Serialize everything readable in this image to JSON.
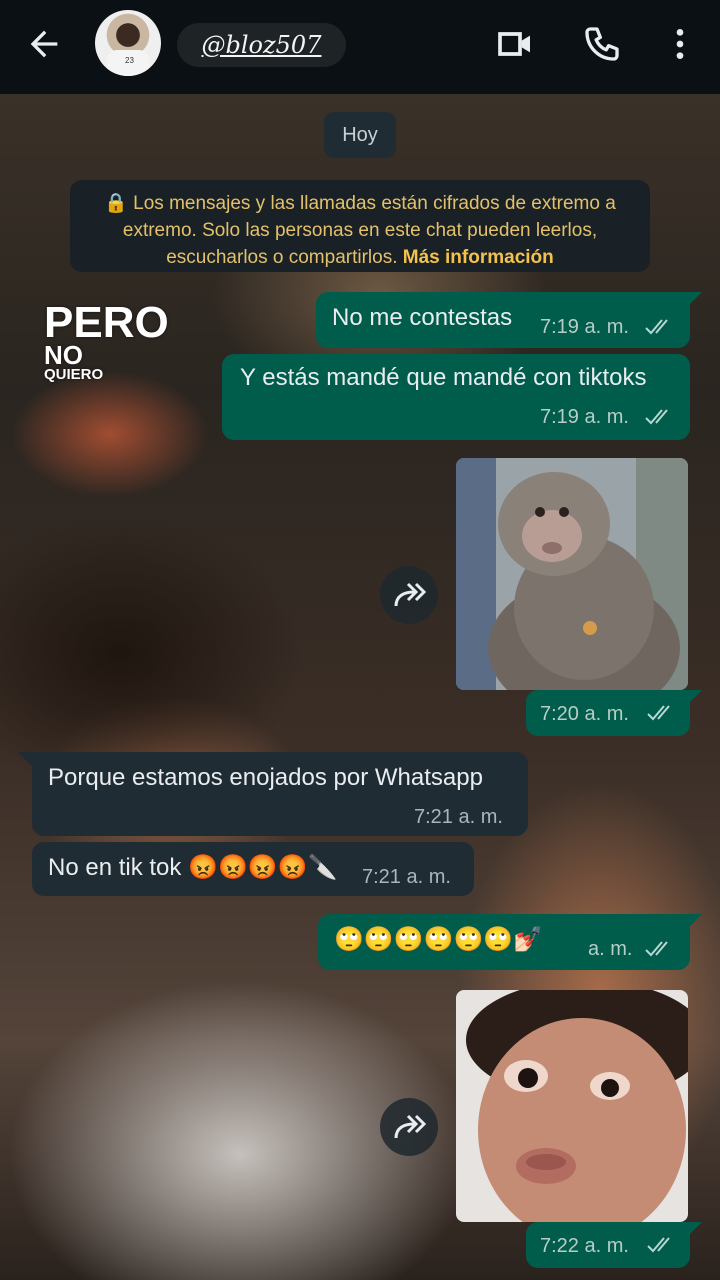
{
  "header": {
    "contact_name": "@bloz507",
    "avatar_jersey_number": "23",
    "icons": {
      "back": "arrow-left-icon",
      "video": "video-call-icon",
      "call": "phone-icon",
      "menu": "more-vert-icon"
    }
  },
  "chat": {
    "date_label": "Hoy",
    "encryption_notice": "Los mensajes y las llamadas están cifrados de extremo a extremo. Solo las personas en este chat pueden leerlos, escucharlos o compartirlos.",
    "encryption_link": "Más información",
    "overlay_text": {
      "line1": "PERO",
      "line2": "NO",
      "line3": "QUIERO"
    },
    "messages": [
      {
        "dir": "out",
        "text": "No me contestas",
        "time": "7:19 a. m.",
        "status": "read"
      },
      {
        "dir": "out",
        "text": "Y estás mandé que mandé con tiktoks",
        "time": "7:19 a. m.",
        "status": "read"
      },
      {
        "dir": "out",
        "type": "image",
        "image": "monkey-meme",
        "time": "7:20 a. m.",
        "status": "read"
      },
      {
        "dir": "in",
        "text": "Porque estamos enojados por Whatsapp",
        "time": "7:21 a. m."
      },
      {
        "dir": "in",
        "text": "No en tik tok 😡😡😡😡🔪",
        "time": "7:21 a. m."
      },
      {
        "dir": "out",
        "text": "🙄🙄🙄🙄🙄🙄💅🏻",
        "time": "a. m.",
        "status": "read"
      },
      {
        "dir": "out",
        "type": "image",
        "image": "baby-face-meme",
        "time": "7:22 a. m.",
        "status": "read"
      }
    ]
  },
  "colors": {
    "outgoing": "#005c4b",
    "incoming": "#1f2c33",
    "topbar": "#0b1014",
    "link": "#f3c24b"
  }
}
